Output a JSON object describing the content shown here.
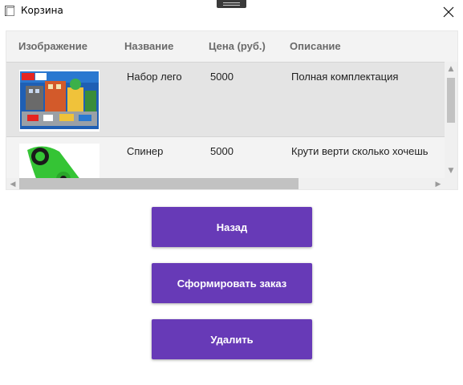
{
  "window": {
    "title": "Корзина"
  },
  "grid": {
    "columns": [
      "Изображение",
      "Название",
      "Цена (руб.)",
      "Описание"
    ],
    "rows": [
      {
        "name": "Набор лего",
        "price": "5000",
        "description": "Полная комплектация"
      },
      {
        "name": "Спинер",
        "price": "5000",
        "description": "Крути верти сколько хочешь"
      }
    ]
  },
  "buttons": {
    "back": "Назад",
    "order": "Сформировать заказ",
    "delete": "Удалить"
  },
  "colors": {
    "accent": "#673ab7",
    "selected_row": "#e4e4e4",
    "grid_background": "#f3f3f3"
  }
}
